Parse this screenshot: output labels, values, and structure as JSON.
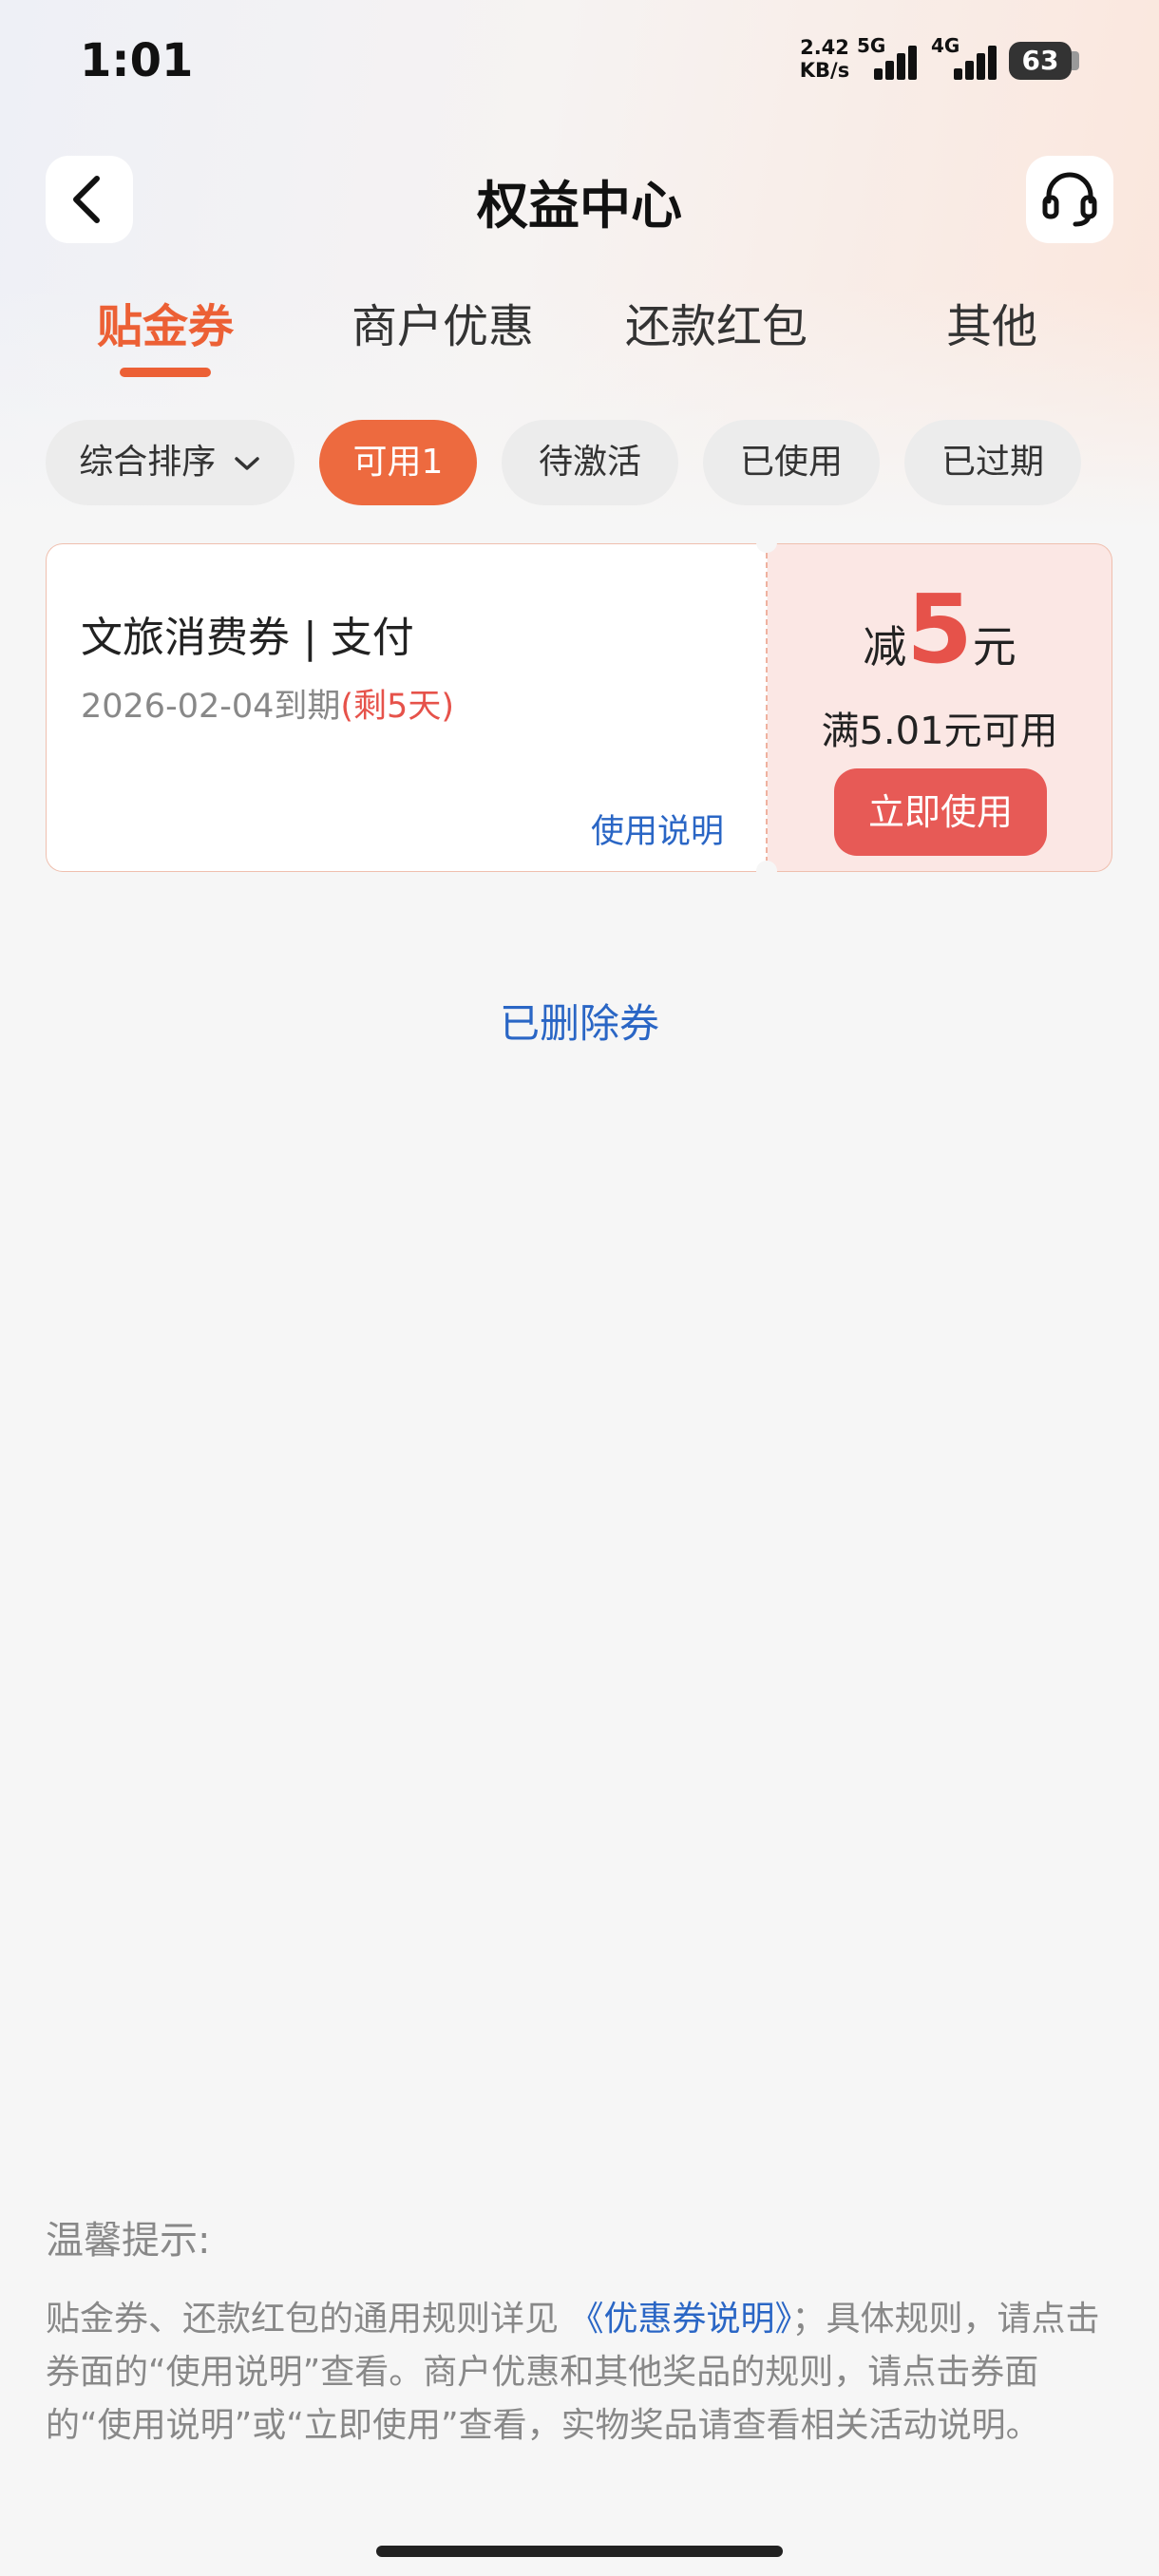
{
  "status_bar": {
    "time": "1:01",
    "net_speed_value": "2.42",
    "net_speed_unit": "KB/s",
    "signal_1_label": "5G",
    "signal_2_label": "4G",
    "battery": "63"
  },
  "header": {
    "title": "权益中心",
    "back_icon": "chevron-left-icon",
    "support_icon": "headset-icon"
  },
  "tabs": [
    {
      "label": "贴金券",
      "active": true
    },
    {
      "label": "商户优惠",
      "active": false
    },
    {
      "label": "还款红包",
      "active": false
    },
    {
      "label": "其他",
      "active": false
    }
  ],
  "filters": {
    "sort_label": "综合排序",
    "chips": [
      {
        "label": "可用1",
        "active": true
      },
      {
        "label": "待激活",
        "active": false
      },
      {
        "label": "已使用",
        "active": false
      },
      {
        "label": "已过期",
        "active": false
      }
    ]
  },
  "coupon": {
    "title": "文旅消费券 | 支付",
    "expiry_text": "2026-02-04到期",
    "remaining_text": "(剩5天)",
    "usage_link": "使用说明",
    "amount_prefix": "减",
    "amount_value": "5",
    "amount_unit": "元",
    "threshold": "满5.01元可用",
    "use_button": "立即使用"
  },
  "deleted_coupons_link": "已删除券",
  "tips": {
    "title": "温馨提示:",
    "text_before_link": "贴金券、还款红包的通用规则详见",
    "link_text": "《优惠券说明》",
    "text_after_link": "；具体规则，请点击券面的“使用说明”查看。商户优惠和其他奖品的规则，请点击券面的“使用说明”或“立即使用”查看，实物奖品请查看相关活动说明。"
  },
  "colors": {
    "accent": "#ec6035",
    "coupon_red": "#e6524a",
    "link_blue": "#2a66c5",
    "background": "#f6f6f6"
  }
}
